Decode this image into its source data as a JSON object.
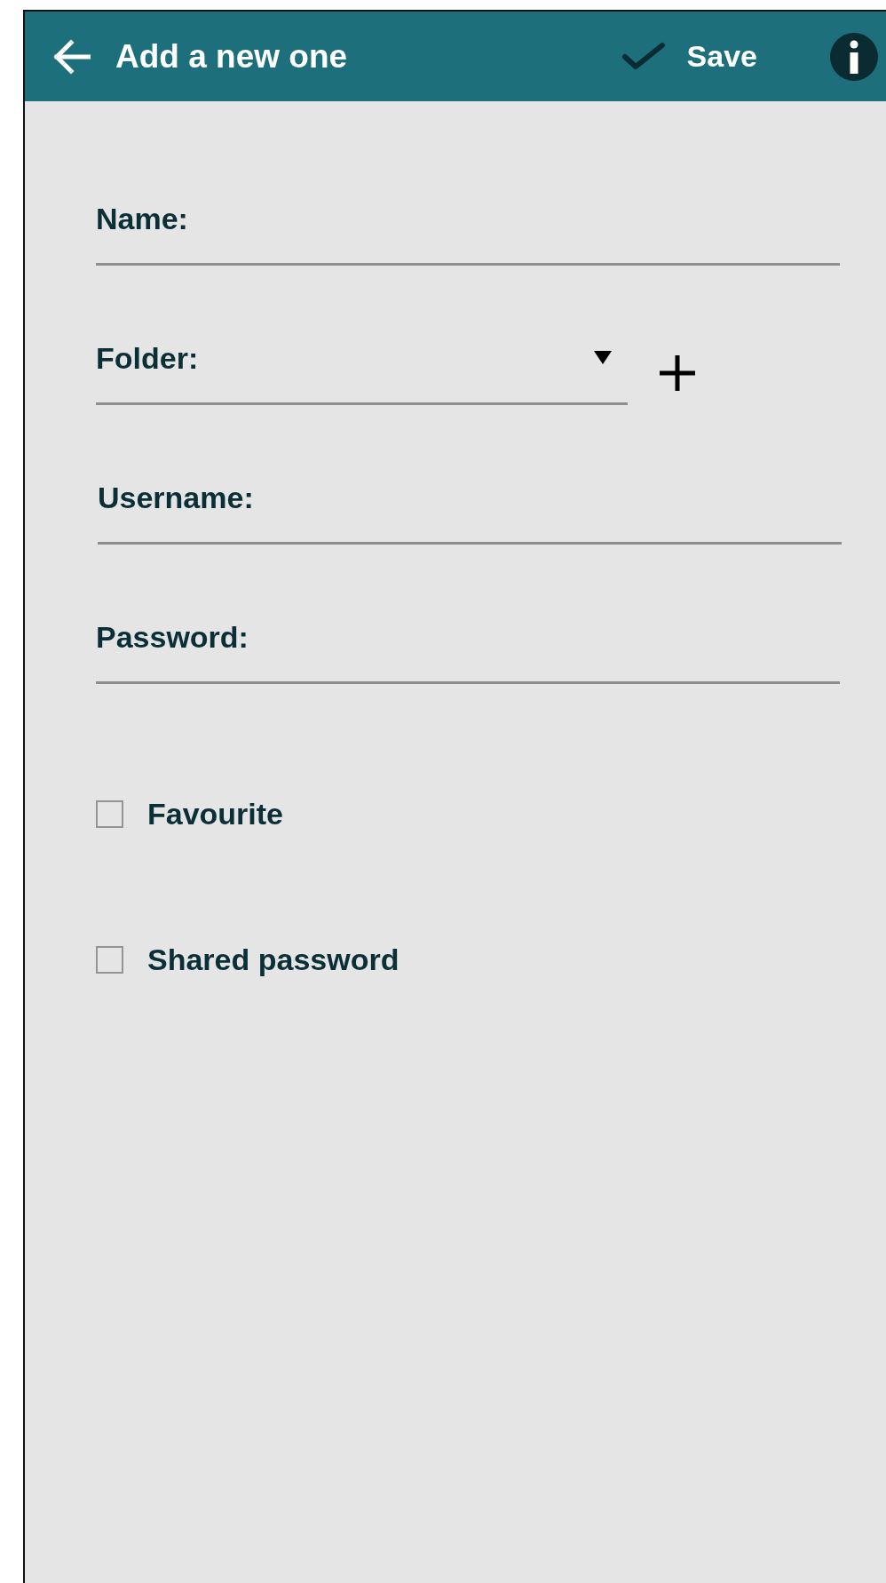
{
  "header": {
    "title": "Add a new one",
    "save_label": "Save"
  },
  "fields": [
    {
      "kind": "text",
      "label": "Name:"
    },
    {
      "kind": "dropdown",
      "label": "Folder:"
    },
    {
      "kind": "text",
      "label": "Username:"
    },
    {
      "kind": "text",
      "label": "Password:"
    }
  ],
  "options": [
    {
      "label": "Favourite",
      "checked": false
    },
    {
      "label": "Shared password",
      "checked": false
    }
  ]
}
